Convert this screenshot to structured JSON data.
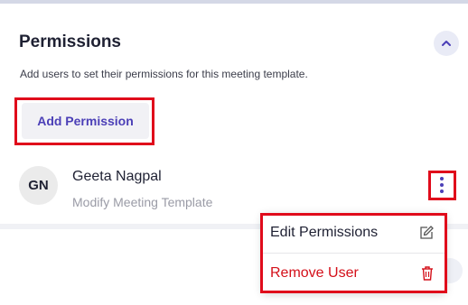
{
  "section": {
    "title": "Permissions",
    "description": "Add users to set their permissions for this meeting template.",
    "add_button_label": "Add Permission"
  },
  "user": {
    "initials": "GN",
    "name": "Geeta Nagpal",
    "role": "Modify Meeting Template"
  },
  "menu": {
    "edit_label": "Edit Permissions",
    "remove_label": "Remove User"
  },
  "icons": {
    "collapse": "chevron-up-icon",
    "more": "kebab-menu-icon",
    "edit": "edit-icon",
    "remove": "trash-icon"
  },
  "colors": {
    "accent": "#4b3fb7",
    "danger": "#d4101a",
    "highlight": "#e00b1b"
  }
}
